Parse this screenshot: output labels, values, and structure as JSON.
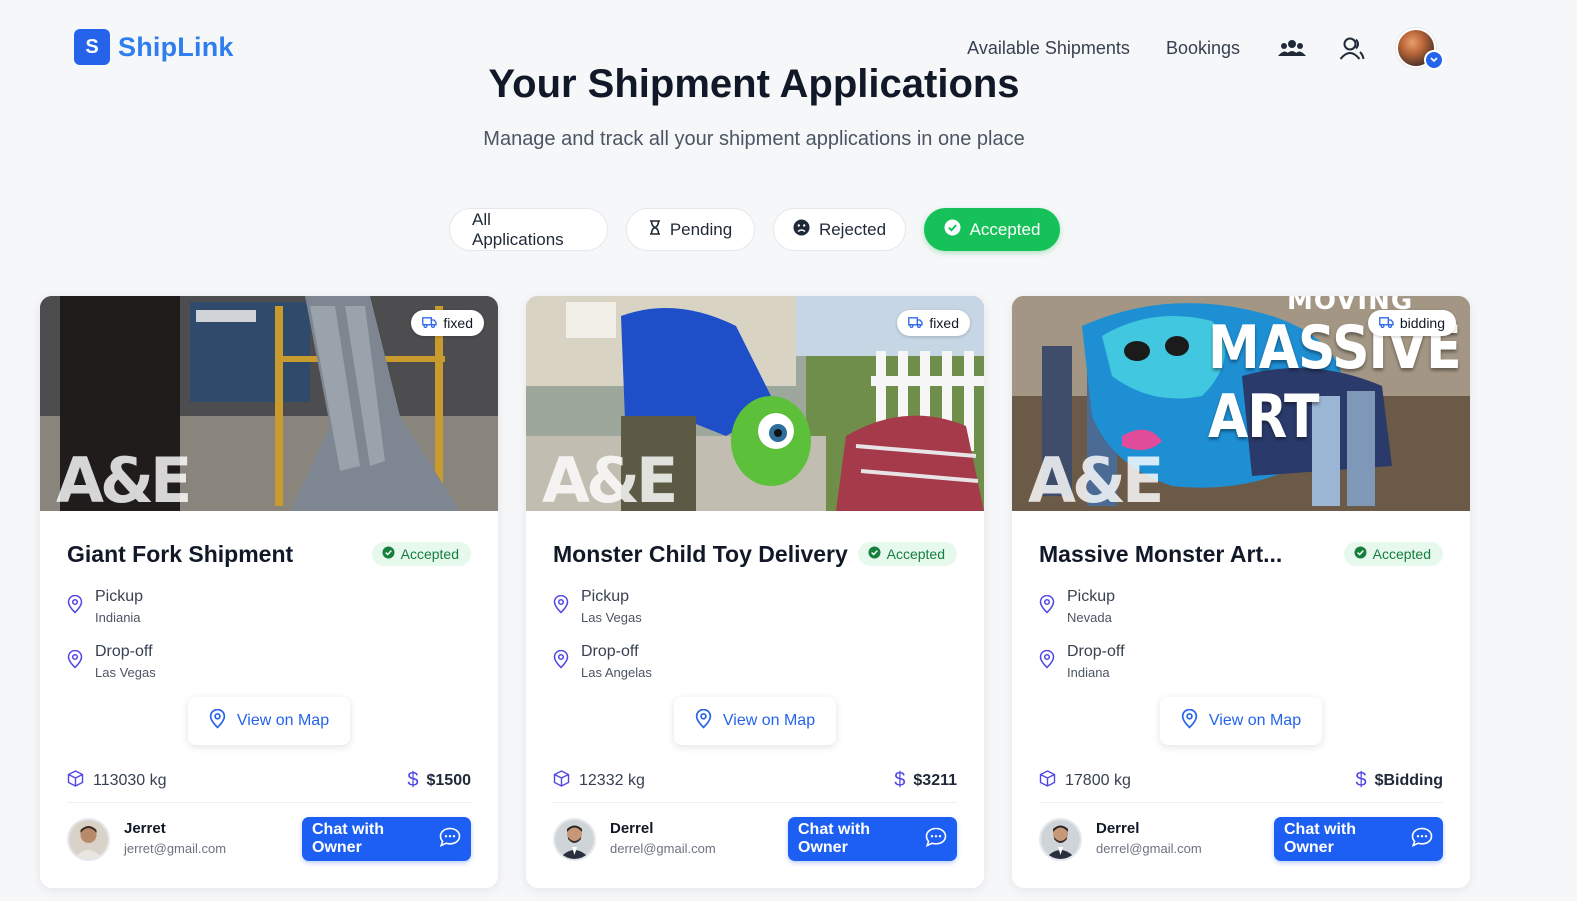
{
  "brand": {
    "logo_letter": "S",
    "name": "ShipLink"
  },
  "nav": {
    "links": [
      "Available Shipments",
      "Bookings"
    ],
    "icons": [
      "users-group-icon",
      "user-icon"
    ],
    "avatar": "user-avatar"
  },
  "header": {
    "title": "Your Shipment Applications",
    "subtitle": "Manage and track all your shipment applications in one place"
  },
  "filters": [
    {
      "label": "All Applications",
      "icon": "",
      "active": false
    },
    {
      "label": "Pending",
      "icon": "hourglass-icon",
      "active": false
    },
    {
      "label": "Rejected",
      "icon": "frown-icon",
      "active": false
    },
    {
      "label": "Accepted",
      "icon": "check-circle-icon",
      "active": true
    }
  ],
  "colors": {
    "accent": "#2563eb",
    "brand": "#2f7ef0",
    "accepted": "#16c15a"
  },
  "cards": [
    {
      "title": "Giant Fork Shipment",
      "status": "Accepted",
      "type": "fixed",
      "image_watermark": "A&E",
      "pickup_label": "Pickup",
      "pickup": "Indiania",
      "dropoff_label": "Drop-off",
      "dropoff": "Las Vegas",
      "map_label": "View on Map",
      "weight": "113030 kg",
      "price": "$1500",
      "owner_name": "Jerret",
      "owner_email": "jerret@gmail.com",
      "chat_label": "Chat with Owner"
    },
    {
      "title": "Monster Child Toy Delivery",
      "status": "Accepted",
      "type": "fixed",
      "image_watermark": "A&E",
      "pickup_label": "Pickup",
      "pickup": "Las Vegas",
      "dropoff_label": "Drop-off",
      "dropoff": "Las Angelas",
      "map_label": "View on Map",
      "weight": "12332 kg",
      "price": "$3211",
      "owner_name": "Derrel",
      "owner_email": "derrel@gmail.com",
      "chat_label": "Chat with Owner"
    },
    {
      "title": "Massive Monster Art...",
      "status": "Accepted",
      "type": "bidding",
      "image_watermark": "A&E",
      "image_overlay_top": "MOVING",
      "image_overlay_main": "MASSIVE ART",
      "pickup_label": "Pickup",
      "pickup": "Nevada",
      "dropoff_label": "Drop-off",
      "dropoff": "Indiana",
      "map_label": "View on Map",
      "weight": "17800 kg",
      "price": "$Bidding",
      "owner_name": "Derrel",
      "owner_email": "derrel@gmail.com",
      "chat_label": "Chat with Owner"
    }
  ]
}
